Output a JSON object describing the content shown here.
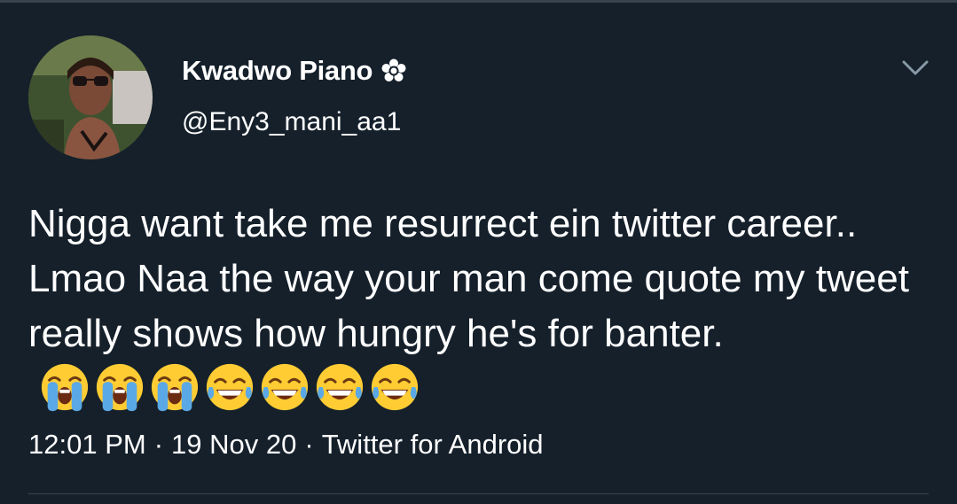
{
  "tweet": {
    "author": {
      "display_name": "Kwadwo Piano",
      "handle": "@Eny3_mani_aa1",
      "badge_icon": "flower-badge-icon"
    },
    "text": "Nigga want take me resurrect ein twitter career.. Lmao Naa the way your man come quote my tweet really shows how hungry he's for banter.",
    "emojis": [
      "😭",
      "😭",
      "😭",
      "😂",
      "😂",
      "😂",
      "😂"
    ],
    "time": "12:01 PM",
    "separator": "·",
    "date": "19 Nov 20",
    "source": "Twitter for Android"
  },
  "ui": {
    "more_icon": "chevron-down-icon"
  },
  "colors": {
    "background": "#15202b",
    "divider": "#38444d",
    "text": "#ffffff",
    "muted": "#8899a6"
  }
}
